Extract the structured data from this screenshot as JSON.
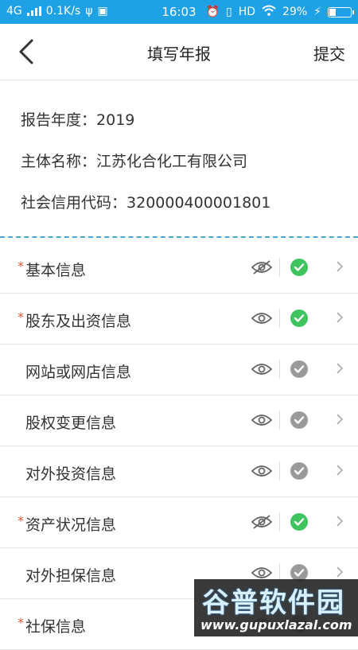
{
  "status_bar": {
    "network": "4G",
    "speed": "0.1K/s",
    "time": "16:03",
    "hd": "HD",
    "battery_percent": "29%",
    "battery_level": 0.29
  },
  "nav": {
    "title": "填写年报",
    "submit_label": "提交"
  },
  "info": {
    "year_label": "报告年度：",
    "year_value": "2019",
    "name_label": "主体名称：",
    "name_value": "江苏化合化工有限公司",
    "code_label": "社会信用代码：",
    "code_value": "320000400001801"
  },
  "sections": [
    {
      "label": "基本信息",
      "required": true,
      "visibility": "hidden",
      "status": "done"
    },
    {
      "label": "股东及出资信息",
      "required": true,
      "visibility": "visible",
      "status": "done"
    },
    {
      "label": "网站或网店信息",
      "required": false,
      "visibility": "visible",
      "status": "pending"
    },
    {
      "label": "股权变更信息",
      "required": false,
      "visibility": "visible",
      "status": "pending"
    },
    {
      "label": "对外投资信息",
      "required": false,
      "visibility": "visible",
      "status": "pending"
    },
    {
      "label": "资产状况信息",
      "required": true,
      "visibility": "hidden",
      "status": "done"
    },
    {
      "label": "对外担保信息",
      "required": false,
      "visibility": "visible",
      "status": "pending"
    },
    {
      "label": "社保信息",
      "required": true,
      "visibility": "visible",
      "status": "pending"
    }
  ],
  "watermark": {
    "line1": "谷普软件园",
    "line2": "www.gupuxlazal.com"
  },
  "colors": {
    "accent": "#1fa1e6",
    "done": "#3ec35f",
    "pending": "#9a9a9a",
    "required_star": "#e0553b"
  }
}
